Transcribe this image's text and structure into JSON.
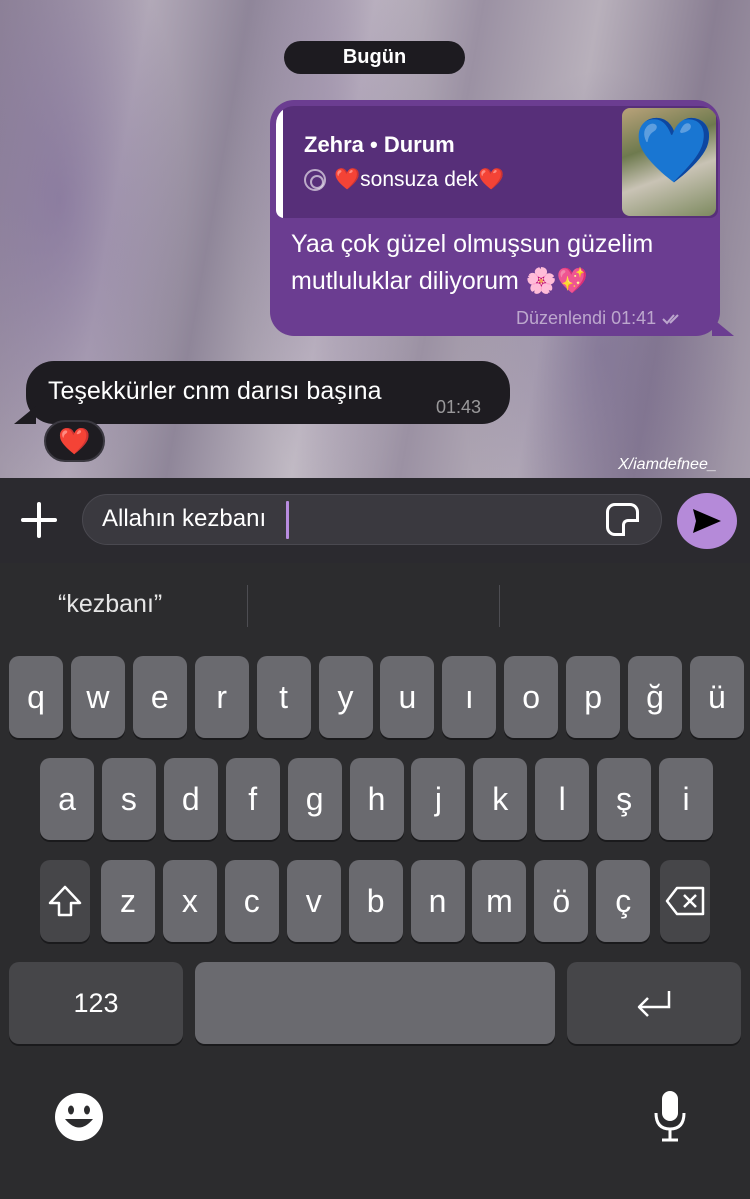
{
  "chat": {
    "date_label": "Bugün",
    "outgoing": {
      "reply_title": "Zehra • Durum",
      "reply_text": "❤️sonsuza dek❤️",
      "thumb_icon": "💙",
      "text": "Yaa çok güzel olmuşsun güzelim mutluluklar diliyorum 🌸💖",
      "meta": "Düzenlendi 01:41",
      "read_icon": "double-check-icon"
    },
    "incoming": {
      "text": "Teşekkürler cnm darısı başına",
      "time": "01:43",
      "reaction": "❤️"
    },
    "watermark": "X/iamdefnee_"
  },
  "input": {
    "value": "Allahın kezbanı",
    "attach_icon": "plus-icon",
    "sticker_icon": "sticker-icon",
    "send_icon": "send-icon",
    "accent": "#b58ad9"
  },
  "keyboard": {
    "suggestions": [
      "“kezbanı”",
      "",
      ""
    ],
    "row1": [
      "q",
      "w",
      "e",
      "r",
      "t",
      "y",
      "u",
      "ı",
      "o",
      "p",
      "ğ",
      "ü"
    ],
    "row2": [
      "a",
      "s",
      "d",
      "f",
      "g",
      "h",
      "j",
      "k",
      "l",
      "ş",
      "i"
    ],
    "row3": [
      "z",
      "x",
      "c",
      "v",
      "b",
      "n",
      "m",
      "ö",
      "ç"
    ],
    "numbers_label": "123",
    "emoji_icon": "emoji-icon",
    "mic_icon": "microphone-icon"
  }
}
